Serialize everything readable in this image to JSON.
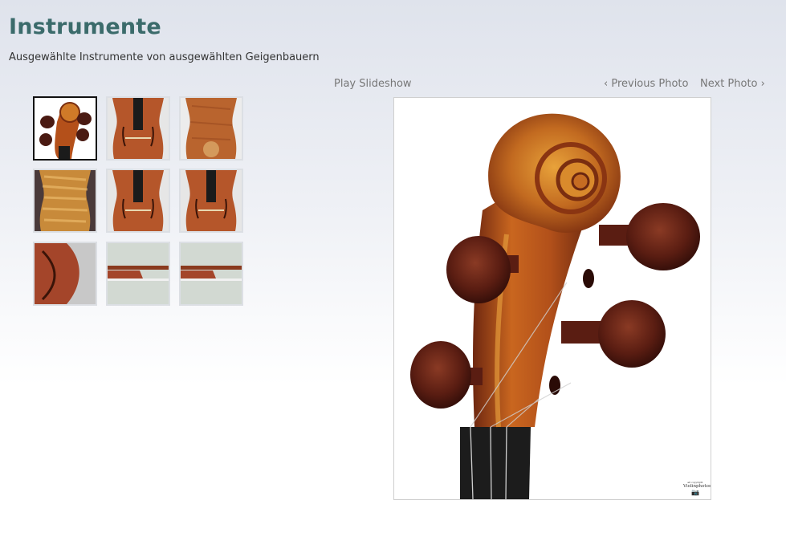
{
  "page": {
    "title": "Instrumente",
    "subtitle": "Ausgewählte Instrumente von ausgewählten Geigenbauern"
  },
  "controls": {
    "play_label": "Play Slideshow",
    "prev_label": "‹ Previous Photo",
    "next_label": "Next Photo ›"
  },
  "thumbnails": [
    {
      "subject": "violin-scroll",
      "selected": true
    },
    {
      "subject": "violin-top-body",
      "selected": false
    },
    {
      "subject": "violin-back-body",
      "selected": false
    },
    {
      "subject": "violin-back-flamed",
      "selected": false
    },
    {
      "subject": "violin-top-body",
      "selected": false
    },
    {
      "subject": "violin-top-body",
      "selected": false
    },
    {
      "subject": "violin-side-cbout",
      "selected": false
    },
    {
      "subject": "bow-frog",
      "selected": false
    },
    {
      "subject": "bow-frog",
      "selected": false
    }
  ],
  "main_photo": {
    "subject": "violin-scroll",
    "watermark": {
      "small_text": "all copyright",
      "name": "Violinphotos"
    }
  },
  "colors": {
    "title": "#3b6b6b",
    "wood_dark": "#5a1e10",
    "wood_mid": "#b4501a",
    "wood_light": "#e0902c",
    "peg": "#4a1a12",
    "ebony": "#1b1b1b"
  }
}
